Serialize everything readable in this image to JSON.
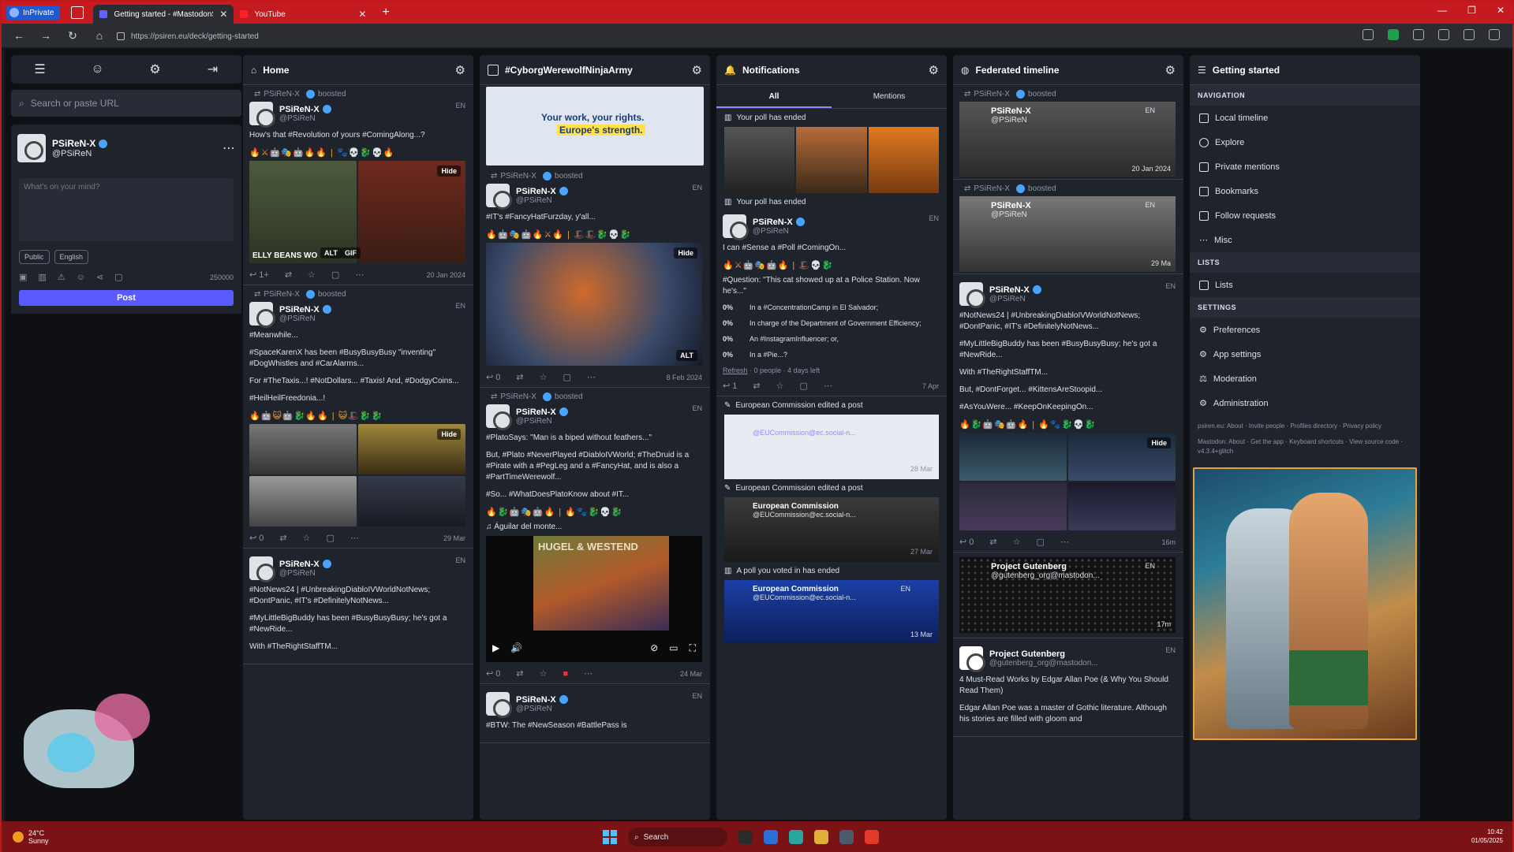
{
  "browser": {
    "inprivate_label": "InPrivate",
    "tabs": [
      {
        "title": "Getting started - #MastodonSpyF",
        "active": true
      },
      {
        "title": "YouTube",
        "active": false
      }
    ],
    "url": "https://psiren.eu/deck/getting-started"
  },
  "left": {
    "search_placeholder": "Search or paste URL",
    "account": {
      "name": "PSiReN-X",
      "handle": "@PSiReN"
    },
    "composer": {
      "placeholder": "What's on your mind?",
      "visibility": "Public",
      "language": "English",
      "char_count": "250000",
      "post_label": "Post"
    }
  },
  "home": {
    "title": "Home",
    "posts": [
      {
        "boost": "PSiReN-X",
        "boost_label": "boosted",
        "name": "PSiReN-X",
        "handle": "@PSiReN",
        "meta": "EN",
        "text": "How's that #Revolution of yours #ComingAlong...?",
        "media_caption": "ELLY BEANS WO",
        "hide": "Hide",
        "alt": "ALT",
        "gif": "GIF",
        "replies": "1+",
        "time": "20 Jan 2024"
      },
      {
        "boost": "PSiReN-X",
        "boost_label": "boosted",
        "name": "PSiReN-X",
        "handle": "@PSiReN",
        "meta": "EN",
        "p1": "#Meanwhile...",
        "p2": "#SpaceKarenX has been #BusyBusyBusy \"inventing\" #DogWhistles and #CarAlarms...",
        "p3": "For #TheTaxis...! #NotDollars... #Taxis! And, #DodgyCoins...",
        "p4": "#HeilHeilFreedonia...!",
        "hide": "Hide",
        "replies": "0",
        "time": "29 Mar"
      },
      {
        "name": "PSiReN-X",
        "handle": "@PSiReN",
        "meta": "EN",
        "p1": "#NotNews24 | #UnbreakingDiabloIVWorldNotNews; #DontPanic, #IT's #DefinitelyNotNews...",
        "p2": "#MyLittleBigBuddy has been #BusyBusyBusy; he's got a #NewRide...",
        "p3": "With #TheRightStaffTM..."
      }
    ]
  },
  "hashtag": {
    "title": "#CyborgWerewolfNinjaArmy",
    "banner_line1": "Your work, your rights.",
    "banner_line2": "Europe's strength.",
    "posts": [
      {
        "boost": "PSiReN-X",
        "boost_label": "boosted",
        "name": "PSiReN-X",
        "handle": "@PSiReN",
        "meta": "EN",
        "text": "#IT's #FancyHatFurzday, y'all...",
        "hide": "Hide",
        "alt": "ALT",
        "replies": "0",
        "time": "8 Feb 2024"
      },
      {
        "boost": "PSiReN-X",
        "boost_label": "boosted",
        "name": "PSiReN-X",
        "handle": "@PSiReN",
        "meta": "EN",
        "p1": "#PlatoSays: \"Man is a biped without feathers...\"",
        "p2": "But, #Plato #NeverPlayed #DiabloIVWorld; #TheDruid is a #Pirate with a #PegLeg and a #FancyHat, and is also a #PartTimeWerewolf...",
        "p3": "#So... #WhatDoesPlatoKnow about #IT...",
        "audio": "Águilar del monte...",
        "video_title": "HUGEL & WESTEND",
        "replies": "0",
        "time": "24 Mar"
      },
      {
        "name": "PSiReN-X",
        "handle": "@PSiReN",
        "meta": "EN",
        "p1": "#BTW: The #NewSeason #BattlePass is"
      }
    ]
  },
  "notifications": {
    "title": "Notifications",
    "tab_all": "All",
    "tab_mentions": "Mentions",
    "n1": "Your poll has ended",
    "n2": "Your poll has ended",
    "poll_post": {
      "name": "PSiReN-X",
      "handle": "@PSiReN",
      "meta": "EN",
      "text": "I can #Sense a #Poll #ComingOn...",
      "question": "#Question: \"This cat showed up at a Police Station. Now he's...\"",
      "options": [
        {
          "pct": "0%",
          "label": "In a #ConcentrationCamp in El Salvador;"
        },
        {
          "pct": "0%",
          "label": "In charge of the Department of Government Efficiency;"
        },
        {
          "pct": "0%",
          "label": "An #InstagramInfluencer; or,"
        },
        {
          "pct": "0%",
          "label": "In a #Pie...?"
        }
      ],
      "refresh": "Refresh",
      "foot": " · 0 people · 4 days left",
      "replies": "1",
      "time": "7 Apr"
    },
    "n3": "European Commission edited a post",
    "n3_handle": "@EUCommission@ec.social-n...",
    "n3_time": "28 Mar",
    "n4": "European Commission edited a post",
    "n4_post": {
      "name": "European Commission",
      "handle": "@EUCommission@ec.social-n...",
      "time": "27 Mar"
    },
    "n5": "A poll you voted in has ended",
    "n5_post": {
      "name": "European Commission",
      "handle": "@EUCommission@ec.social-n...",
      "meta": "EN",
      "time": "13 Mar"
    }
  },
  "federated": {
    "title": "Federated timeline",
    "posts": [
      {
        "boost": "PSiReN-X",
        "boost_label": "boosted",
        "name": "PSiReN-X",
        "handle": "@PSiReN",
        "meta": "EN",
        "time": "20 Jan 2024"
      },
      {
        "boost": "PSiReN-X",
        "boost_label": "boosted",
        "name": "PSiReN-X",
        "handle": "@PSiReN",
        "meta": "EN",
        "time": "29 Ma"
      },
      {
        "name": "PSiReN-X",
        "handle": "@PSiReN",
        "meta": "EN",
        "p1": "#NotNews24 | #UnbreakingDiabloIVWorldNotNews; #DontPanic, #IT's #DefinitelyNotNews...",
        "p2": "#MyLittleBigBuddy has been #BusyBusyBusy; he's got a #NewRide...",
        "p3": "With #TheRightStaffTM...",
        "p4": "But, #DontForget... #KittensAreStoopid...",
        "p5": "#AsYouWere... #KeepOnKeepingOn...",
        "hide": "Hide",
        "replies": "0",
        "time": "16m"
      },
      {
        "name": "Project Gutenberg",
        "handle": "@gutenberg_org@mastodon...",
        "meta": "EN",
        "time": "17m"
      },
      {
        "name": "Project Gutenberg",
        "handle": "@gutenberg_org@mastodon...",
        "meta": "EN",
        "p1": "4 Must-Read Works by Edgar Allan Poe (& Why You Should Read Them)",
        "p2": "Edgar Allan Poe was a master of Gothic literature. Although his stories are filled with gloom and"
      }
    ]
  },
  "getting_started": {
    "title": "Getting started",
    "sections": {
      "navigation": "NAVIGATION",
      "lists": "LISTS",
      "settings": "SETTINGS"
    },
    "nav": [
      "Local timeline",
      "Explore",
      "Private mentions",
      "Bookmarks",
      "Follow requests",
      "Misc"
    ],
    "lists": [
      "Lists"
    ],
    "settings": [
      "Preferences",
      "App settings",
      "Moderation",
      "Administration"
    ],
    "footer1": "psiren.eu: About · Invite people · Profiles directory · Privacy policy",
    "footer2": "Mastodon: About · Get the app · Keyboard shortcuts · View source code · v4.3.4+glitch"
  },
  "taskbar": {
    "temp": "24°C",
    "weather": "Sunny",
    "search": "Search",
    "time": "10:42",
    "date": "01/05/2025"
  },
  "colors": {
    "accent": "#595aff",
    "hashtag": "#8c8dff",
    "frame": "#c41a20",
    "bookmark_on": "#e0383e"
  }
}
